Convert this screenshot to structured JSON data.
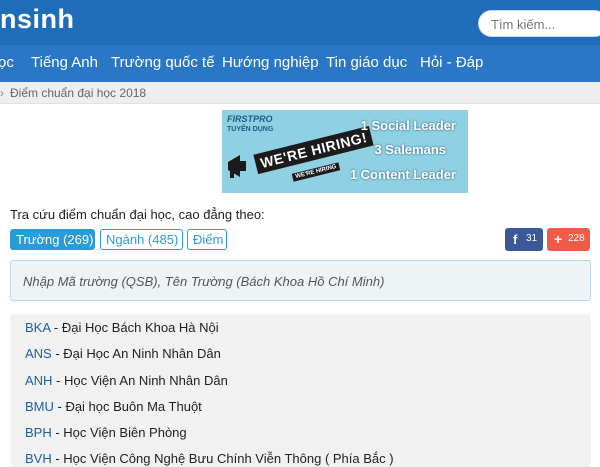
{
  "header": {
    "logo_text": "nsinh",
    "search_placeholder": "Tìm kiếm..."
  },
  "nav": {
    "items": [
      "ọc",
      "Tiếng Anh",
      "Trường quốc tế",
      "Hướng nghiệp",
      "Tin giáo dục",
      "Hỏi - Đáp"
    ]
  },
  "breadcrumb": {
    "separator": "›",
    "current": "Điểm chuẩn đại học 2018"
  },
  "banner": {
    "brand": "FIRSTPRO",
    "subtitle": "TUYỂN DỤNG",
    "hiring_text": "WE'RE HIRING!",
    "hiring_small": "WE'RE HIRING",
    "lines": [
      "1 Social Leader",
      "3 Salemans",
      "1 Content Leader"
    ],
    "bg_color": "#8fd0e3"
  },
  "lookup": {
    "label": "Tra cứu điểm chuẩn đại học, cao đẳng theo:",
    "tabs": [
      {
        "label": "Trường (269)",
        "active": true
      },
      {
        "label": "Ngành (485)",
        "active": false
      },
      {
        "label": "Điểm",
        "active": false
      }
    ]
  },
  "share": {
    "facebook_icon": "facebook-icon",
    "facebook_count": "31",
    "plus_icon": "plus-icon",
    "plus_count": "228"
  },
  "search_box": {
    "placeholder": "Nhập Mã trường (QSB), Tên Trường (Bách Khoa Hồ Chí Minh)"
  },
  "schools": [
    {
      "code": "BKA",
      "name": " - Đại Học Bách Khoa Hà Nội"
    },
    {
      "code": "ANS",
      "name": " - Đại Học An Ninh Nhân Dân"
    },
    {
      "code": "ANH",
      "name": " - Học Viện An Ninh Nhân Dân"
    },
    {
      "code": "BMU",
      "name": " - Đại học Buôn Ma Thuột"
    },
    {
      "code": "BPH",
      "name": " - Học Viện Biên Phòng"
    },
    {
      "code": "BVH",
      "name": " - Học Viện Công Nghệ Bưu Chính Viễn Thông ( Phía Bắc )"
    }
  ],
  "colors": {
    "header_bg": "#1f6cb8",
    "nav_bg": "#2a78c5",
    "tab_accent": "#2a9bd6",
    "facebook": "#3b5998",
    "plus": "#f05a47",
    "school_code": "#1f5fa0"
  }
}
